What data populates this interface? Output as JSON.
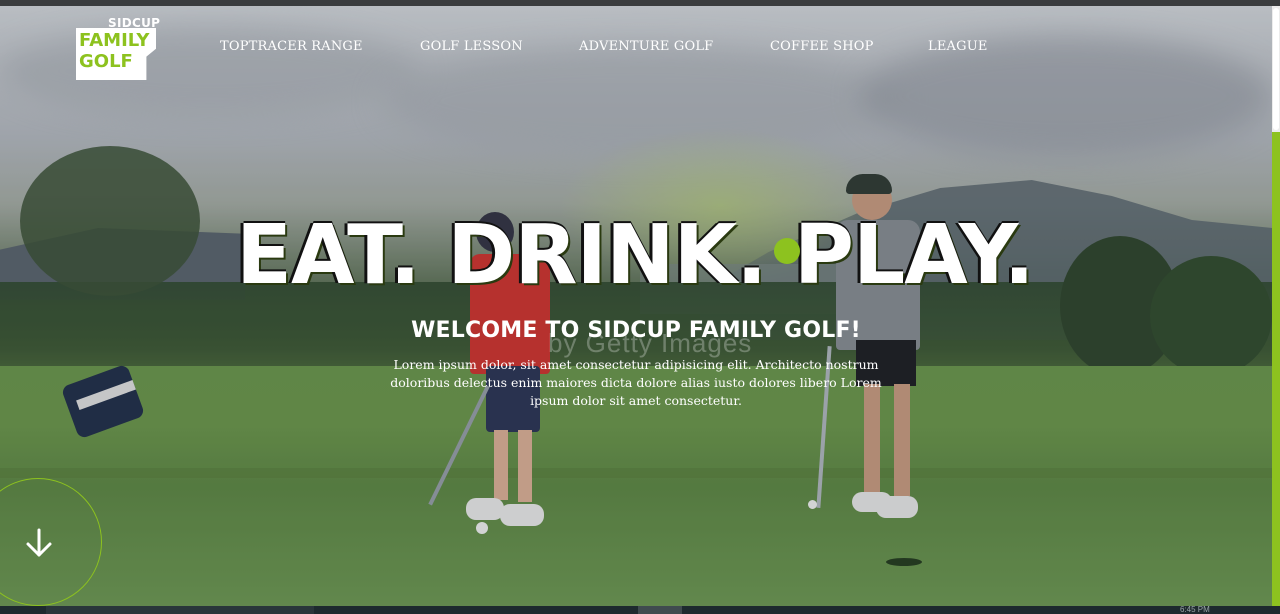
{
  "window": {
    "clock_text": "6:45 PM"
  },
  "logo": {
    "top": "SIDCUP",
    "line1": "FAMILY",
    "line2": "GOLF"
  },
  "nav": {
    "items": [
      {
        "label": "TOPTRACER RANGE"
      },
      {
        "label": "GOLF LESSON"
      },
      {
        "label": "ADVENTURE GOLF"
      },
      {
        "label": "COFFEE SHOP"
      },
      {
        "label": "LEAGUE"
      }
    ]
  },
  "hero": {
    "headline": "EAT. DRINK. PLAY.",
    "welcome": "WELCOME TO SIDCUP FAMILY GOLF!",
    "lead": "Lorem ipsum dolor, sit amet consectetur adipisicing elit. Architecto nostrum doloribus delectus enim maiores dicta dolore alias iusto dolores libero Lorem ipsum dolor sit amet consectetur.",
    "watermark": "by Getty Images",
    "scroll_icon": "arrow-down-icon"
  },
  "colors": {
    "accent": "#8dc21f",
    "text": "#ffffff",
    "scrollbar_track": "#ececec"
  }
}
